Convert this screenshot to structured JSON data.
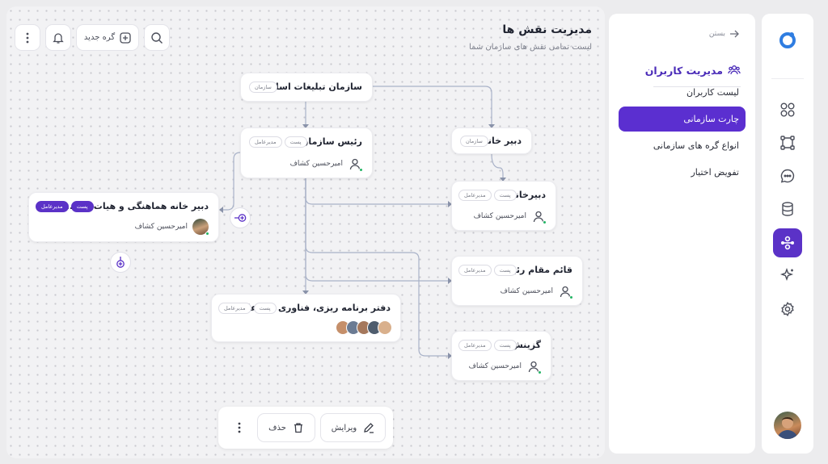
{
  "colors": {
    "accent": "#5b32c7",
    "online": "#22b464"
  },
  "iconbar": {
    "icons": [
      "logo-icon",
      "grid-icon",
      "nodes-icon",
      "chat-icon",
      "database-icon",
      "org-chart-icon",
      "sparkle-icon",
      "gear-icon"
    ],
    "active": "org-chart-icon"
  },
  "sidebar": {
    "back_label": "بستن",
    "title": "مدیریت کاربران",
    "items": [
      {
        "label": "لیست کاربران"
      },
      {
        "label": "چارت سازمانی",
        "active": true
      },
      {
        "label": "انواع گره های سازمانی"
      },
      {
        "label": "تفویض اختیار"
      }
    ]
  },
  "header": {
    "title": "مدیریت نقش ها",
    "subtitle": "لیست تمامی نقش های سازمان شما"
  },
  "toolbar": {
    "new_node_label": "گره جدید"
  },
  "nodes": {
    "org": {
      "title": "سازمان تبلیغات اسلامی",
      "badge": "سازمان"
    },
    "head": {
      "title": "رئیس سازمان",
      "badges": [
        "پست",
        "مدیرعامل"
      ],
      "person": "امیرحسین کشاف"
    },
    "secretariat": {
      "title": "دبیر خانه",
      "badge": "سازمان"
    },
    "secretary": {
      "title": "دبیرخانه",
      "badges": [
        "پست",
        "مدیرعامل"
      ],
      "person": "امیرحسین کشاف"
    },
    "coordination": {
      "title": "دبیر خانه هماهنگی و هیات های...",
      "badges": [
        "پست",
        "مدیرعامل"
      ],
      "person": "امیرحسین کشاف"
    },
    "deputy": {
      "title": "قائم مقام رئیس",
      "badges": [
        "پست",
        "مدیرعامل"
      ],
      "person": "امیرحسین کشاف"
    },
    "planning": {
      "title": "دفتر برنامه ریزی، فناوری اطلاعا...",
      "badges": [
        "پست",
        "مدیرعامل"
      ]
    },
    "selection": {
      "title": "گزینش",
      "badges": [
        "پست",
        "مدیرعامل"
      ],
      "person": "امیرحسین کشاف"
    }
  },
  "bottom_bar": {
    "edit_label": "ویرایش",
    "delete_label": "حذف"
  }
}
